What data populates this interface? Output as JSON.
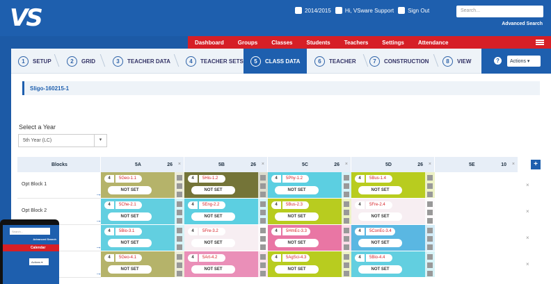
{
  "header": {
    "logo": "VS",
    "year": "2014/2015",
    "user": "Hi, VSware Support",
    "signout": "Sign Out",
    "search_placeholder": "Search...",
    "advanced_search": "Advanced Search"
  },
  "menu": [
    "Dashboard",
    "Groups",
    "Classes",
    "Students",
    "Teachers",
    "Settings",
    "Attendance"
  ],
  "steps": [
    {
      "num": "1",
      "label": "SETUP"
    },
    {
      "num": "2",
      "label": "GRID"
    },
    {
      "num": "3",
      "label": "TEACHER DATA"
    },
    {
      "num": "4",
      "label": "TEACHER SETS"
    },
    {
      "num": "5",
      "label": "CLASS DATA"
    },
    {
      "num": "6",
      "label": "TEACHER"
    },
    {
      "num": "7",
      "label": "CONSTRUCTION"
    },
    {
      "num": "8",
      "label": "VIEW"
    }
  ],
  "actions": {
    "help": "?",
    "label": "Actions ▾"
  },
  "timetable_name": "Sligo-160215-1",
  "year_select": {
    "label": "Select a Year",
    "value": "5th Year (LC)",
    "arrow": "▾"
  },
  "grid": {
    "blocks_header": "Blocks",
    "columns": [
      {
        "name": "5A",
        "count": "26"
      },
      {
        "name": "5B",
        "count": "26"
      },
      {
        "name": "5C",
        "count": "26"
      },
      {
        "name": "5D",
        "count": "26"
      },
      {
        "name": "5E",
        "count": "10"
      }
    ],
    "rows": [
      {
        "label": "Opt Block 1",
        "cells": [
          {
            "n": "4",
            "code": "5Geo-1.1",
            "status": "NOT SET",
            "color": "#b5b36a"
          },
          {
            "n": "4",
            "code": "5His-1.2",
            "status": "NOT SET",
            "color": "#747438"
          },
          {
            "n": "4",
            "code": "5Phy-1.2",
            "status": "NOT SET",
            "color": "#5ccfe1"
          },
          {
            "n": "4",
            "code": "5Bus-1.4",
            "status": "NOT SET",
            "color": "#b8cc1f"
          }
        ]
      },
      {
        "label": "Opt Block 2",
        "cells": [
          {
            "n": "4",
            "code": "5Che-2.1",
            "status": "NOT SET",
            "color": "#62cfe0"
          },
          {
            "n": "4",
            "code": "5Eng-2.2",
            "status": "NOT SET",
            "color": "#5ccfe1"
          },
          {
            "n": "4",
            "code": "5Bus-2.3",
            "status": "NOT SET",
            "color": "#b8cc1f"
          },
          {
            "n": "4",
            "code": "5Fre-2.4",
            "status": "NOT SET",
            "color": "#f7eef2"
          }
        ]
      },
      {
        "label": "",
        "cells": [
          {
            "n": "4",
            "code": "5Bio-3.1",
            "status": "NOT SET",
            "color": "#62cfe0"
          },
          {
            "n": "4",
            "code": "5Fre-3.2",
            "status": "NOT SET",
            "color": "#f7eef2"
          },
          {
            "n": "4",
            "code": "5HmEc-3.3",
            "status": "NOT SET",
            "color": "#e976a4"
          },
          {
            "n": "4",
            "code": "5ConEc-3.4",
            "status": "NOT SET",
            "color": "#5ab7e2"
          }
        ]
      },
      {
        "label": "",
        "cells": [
          {
            "n": "4",
            "code": "5Geo-4.1",
            "status": "NOT SET",
            "color": "#b5b36a"
          },
          {
            "n": "4",
            "code": "5Art-4.2",
            "status": "NOT SET",
            "color": "#ea8fb8"
          },
          {
            "n": "4",
            "code": "5AgSci-4.3",
            "status": "NOT SET",
            "color": "#b8cc1f"
          },
          {
            "n": "4",
            "code": "5Bio-4.4",
            "status": "NOT SET",
            "color": "#62cfe0"
          }
        ]
      }
    ],
    "close_glyph": "×",
    "add_glyph": "+"
  },
  "tablet": {
    "search_placeholder": "Search...",
    "advanced_search": "Advanced Search",
    "menu_item": "Calendar",
    "actions": "Actions ▾"
  }
}
